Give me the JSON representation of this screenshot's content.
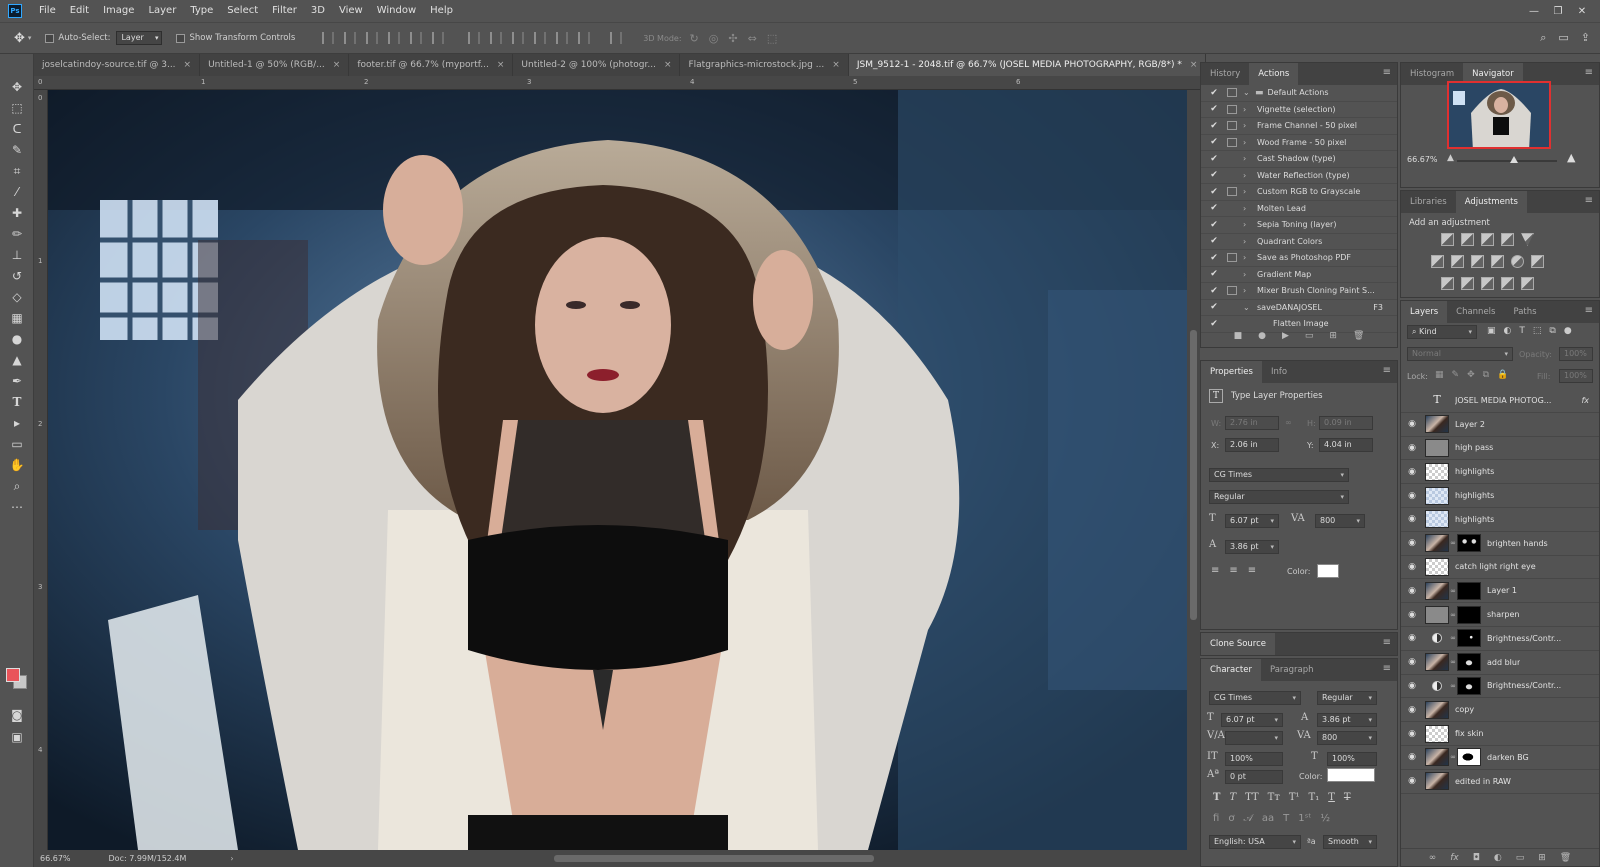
{
  "app": {
    "logo": "Ps"
  },
  "menu": [
    "File",
    "Edit",
    "Image",
    "Layer",
    "Type",
    "Select",
    "Filter",
    "3D",
    "View",
    "Window",
    "Help"
  ],
  "options": {
    "auto_select_label": "Auto-Select:",
    "auto_select_value": "Layer",
    "transform_label": "Show Transform Controls",
    "mode_3d_label": "3D Mode:"
  },
  "doc_tabs": [
    {
      "label": "joselcatindoy-source.tif @ 3...",
      "active": false
    },
    {
      "label": "Untitled-1 @ 50% (RGB/...",
      "active": false
    },
    {
      "label": "footer.tif @ 66.7% (myportf...",
      "active": false
    },
    {
      "label": "Untitled-2 @ 100% (photogr...",
      "active": false
    },
    {
      "label": "Flatgraphics-microstock.jpg ...",
      "active": false
    },
    {
      "label": "JSM_9512-1 - 2048.tif @ 66.7% (JOSEL MEDIA PHOTOGRAPHY, RGB/8*) *",
      "active": true
    }
  ],
  "ruler": {
    "top": [
      "0",
      "1",
      "2",
      "3",
      "4",
      "5",
      "6"
    ],
    "left": [
      "0",
      "1",
      "2",
      "3",
      "4"
    ]
  },
  "status": {
    "zoom": "66.67%",
    "doc": "Doc: 7.99M/152.4M"
  },
  "history_panel": {
    "tabs": [
      "History",
      "Actions"
    ],
    "actions": [
      {
        "name": "Default Actions",
        "type": "folder",
        "box": true
      },
      {
        "name": "Vignette (selection)",
        "box": true
      },
      {
        "name": "Frame Channel - 50 pixel",
        "box": true
      },
      {
        "name": "Wood Frame - 50 pixel",
        "box": true
      },
      {
        "name": "Cast Shadow (type)",
        "box": false
      },
      {
        "name": "Water Reflection (type)",
        "box": false
      },
      {
        "name": "Custom RGB to Grayscale",
        "box": true
      },
      {
        "name": "Molten Lead",
        "box": false
      },
      {
        "name": "Sepia Toning (layer)",
        "box": false
      },
      {
        "name": "Quadrant Colors",
        "box": false
      },
      {
        "name": "Save as Photoshop PDF",
        "box": true
      },
      {
        "name": "Gradient Map",
        "box": false
      },
      {
        "name": "Mixer Brush Cloning Paint S...",
        "box": true
      },
      {
        "name": "saveDANAJOSEL",
        "box": false,
        "key": "F3",
        "expanded": true
      },
      {
        "name": "Flatten Image",
        "box": false,
        "child": true
      }
    ]
  },
  "nav_panel": {
    "tabs": [
      "Histogram",
      "Navigator"
    ],
    "zoom": "66.67%"
  },
  "adj_panel": {
    "tabs": [
      "Libraries",
      "Adjustments"
    ],
    "title": "Add an adjustment"
  },
  "props_panel": {
    "tabs": [
      "Properties",
      "Info"
    ],
    "title": "Type Layer Properties",
    "w_label": "W:",
    "w_value": "2.76 in",
    "h_label": "H:",
    "h_value": "0.09 in",
    "x_label": "X:",
    "x_value": "2.06 in",
    "y_label": "Y:",
    "y_value": "4.04 in",
    "font": "CG Times",
    "style": "Regular",
    "size": "6.07 pt",
    "tracking": "800",
    "leading": "3.86 pt",
    "color_label": "Color:"
  },
  "clone_panel": {
    "tabs": [
      "Clone Source"
    ]
  },
  "char_panel": {
    "tabs": [
      "Character",
      "Paragraph"
    ],
    "font": "CG Times",
    "style": "Regular",
    "size": "6.07 pt",
    "leading": "3.86 pt",
    "tracking": "800",
    "vscale": "100%",
    "hscale": "100%",
    "baseline": "0 pt",
    "color_label": "Color:",
    "language": "English: USA",
    "aa": "Smooth"
  },
  "layers_panel": {
    "tabs": [
      "Layers",
      "Channels",
      "Paths"
    ],
    "kind": "Kind",
    "blend": "Normal",
    "opacity_label": "Opacity:",
    "opacity": "100%",
    "lock_label": "Lock:",
    "fill_label": "Fill:",
    "fill": "100%",
    "layers": [
      {
        "name": "JOSEL MEDIA PHOTOG...",
        "thumb": "text",
        "visible": false,
        "fx": "fx"
      },
      {
        "name": "Layer 2",
        "thumb": "photo",
        "visible": true
      },
      {
        "name": "high pass",
        "thumb": "gray",
        "visible": true
      },
      {
        "name": "highlights",
        "thumb": "checker",
        "visible": true
      },
      {
        "name": "highlights",
        "thumb": "checkblue",
        "visible": true
      },
      {
        "name": "highlights",
        "thumb": "checkblue",
        "visible": true
      },
      {
        "name": "brighten hands",
        "thumb": "photo",
        "visible": true,
        "mask": "hands"
      },
      {
        "name": "catch light right eye",
        "thumb": "checker",
        "visible": true
      },
      {
        "name": "Layer 1",
        "thumb": "photo",
        "visible": true,
        "mask": "black"
      },
      {
        "name": "sharpen",
        "thumb": "gray",
        "visible": true,
        "mask": "black"
      },
      {
        "name": "Brightness/Contr...",
        "thumb": "adj",
        "visible": true,
        "mask": "dot"
      },
      {
        "name": "add blur",
        "thumb": "photo",
        "visible": true,
        "mask": "fig"
      },
      {
        "name": "Brightness/Contr...",
        "thumb": "adj",
        "visible": true,
        "mask": "fig"
      },
      {
        "name": "copy",
        "thumb": "photo",
        "visible": true
      },
      {
        "name": "fix skin",
        "thumb": "checker",
        "visible": true
      },
      {
        "name": "darken BG",
        "thumb": "photo",
        "visible": true,
        "mask": "white"
      },
      {
        "name": "edited in RAW",
        "thumb": "photo",
        "visible": true
      }
    ]
  },
  "colors": {
    "fg": "#e9545a",
    "bg": "#c8c8c8",
    "accent": "#31a8ff"
  }
}
